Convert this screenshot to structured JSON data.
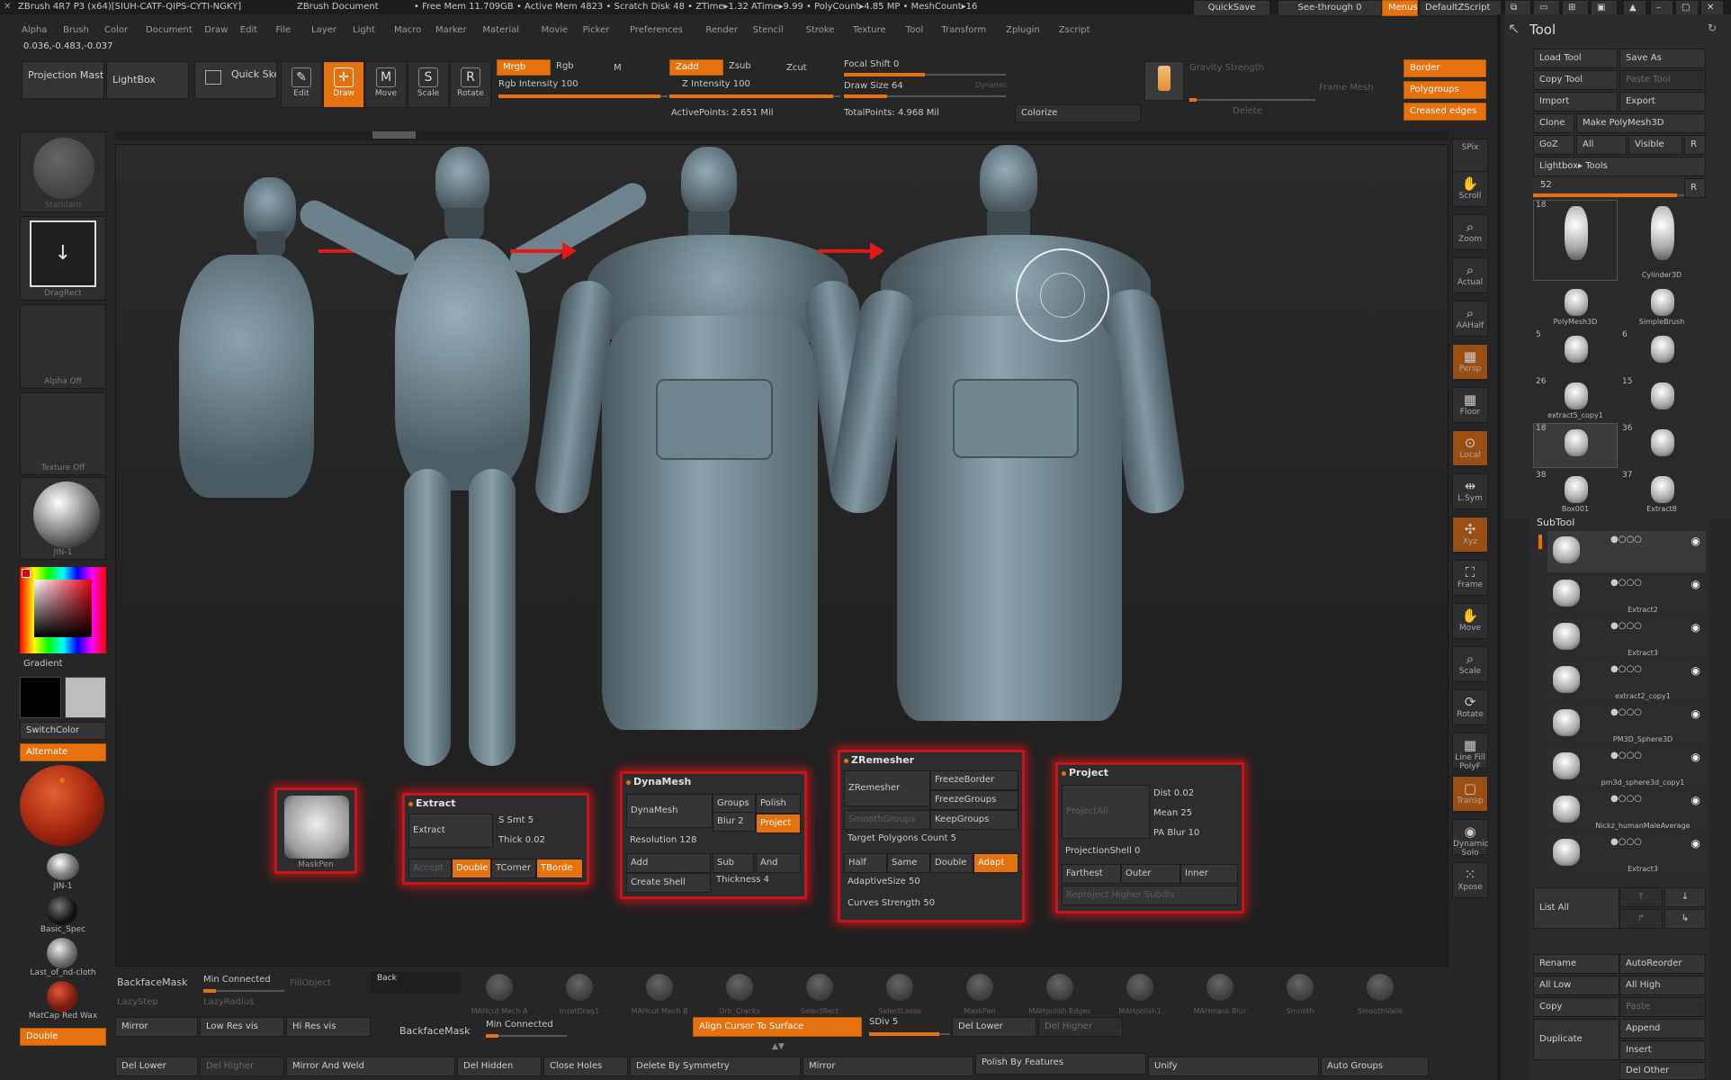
{
  "title_bar": {
    "app": "ZBrush 4R7 P3 (x64)[SIUH-CATF-QIPS-CYTI-NGKY]",
    "doc": "ZBrush Document",
    "stats": "• Free Mem 11.709GB • Active Mem 4823 • Scratch Disk 48 • ZTime▸1.32 ATime▸9.99 • PolyCount▸4.85 MP • MeshCount▸16",
    "quicksave": "QuickSave",
    "seethrough": "See-through 0",
    "menus": "Menus",
    "script": "DefaultZScript"
  },
  "menu": [
    "Alpha",
    "Brush",
    "Color",
    "Document",
    "Draw",
    "Edit",
    "File",
    "Layer",
    "Light",
    "Macro",
    "Marker",
    "Material",
    "Movie",
    "Picker",
    "Preferences",
    "Render",
    "Stencil",
    "Stroke",
    "Texture",
    "Tool",
    "Transform",
    "Zplugin",
    "Zscript"
  ],
  "coords": "0.036,-0.483,-0.037",
  "toolbar": {
    "projection_master": "Projection Master",
    "lightbox": "LightBox",
    "quick_sketch": "Quick Sketch",
    "edit": "Edit",
    "draw": "Draw",
    "move": "Move",
    "scale": "Scale",
    "rotate": "Rotate",
    "mrgb": "Mrgb",
    "rgb": "Rgb",
    "m": "M",
    "rgb_intensity": "Rgb Intensity 100",
    "zadd": "Zadd",
    "zsub": "Zsub",
    "zcut": "Zcut",
    "z_intensity": "Z Intensity 100",
    "focal_shift": "Focal Shift 0",
    "draw_size": "Draw Size 64",
    "dynamic": "Dynamic",
    "active_points": "ActivePoints: 2.651 Mil",
    "total_points": "TotalPoints: 4.968 Mil",
    "colorize": "Colorize",
    "gravity": "Gravity Strength",
    "frame_mesh": "Frame Mesh",
    "delete": "Delete",
    "border": "Border",
    "polygroups": "Polygroups",
    "creased": "Creased edges"
  },
  "left": {
    "standard": "Standard",
    "dragrect": "DragRect",
    "alpha_off": "Alpha Off",
    "texture_off": "Texture Off",
    "jin1": "JIN-1",
    "gradient": "Gradient",
    "switchcolor": "SwitchColor",
    "alternate": "Alternate",
    "jin1b": "JIN-1",
    "basic_spec": "Basic_Spec",
    "last_cloth": "Last_of_nd-cloth",
    "matcap": "MatCap Red Wax",
    "double": "Double"
  },
  "right_shelf": [
    "SPix",
    "Scroll",
    "Zoom",
    "Actual",
    "AAHalf",
    "Persp",
    "Floor",
    "Local",
    "L.Sym",
    "Xyz",
    "Frame",
    "Move",
    "Scale",
    "Rotate",
    "Line Fill PolyF",
    "Transp",
    "Dynamic Solo",
    "Xpose"
  ],
  "tool": {
    "header": "Tool",
    "load": "Load Tool",
    "save_as": "Save As",
    "copy": "Copy Tool",
    "paste": "Paste Tool",
    "import": "Import",
    "export": "Export",
    "clone": "Clone",
    "make_poly": "Make PolyMesh3D",
    "goz": "GoZ",
    "all": "All",
    "visible": "Visible",
    "r": "R",
    "lightbox_tools": "Lightbox▸ Tools",
    "count": "52",
    "items": [
      {
        "n": "18",
        "label": ""
      },
      {
        "n": "",
        "label": "Cylinder3D"
      },
      {
        "n": "",
        "label": "PolyMesh3D"
      },
      {
        "n": "",
        "label": "SimpleBrush"
      },
      {
        "n": "5",
        "label": ""
      },
      {
        "n": "6",
        "label": ""
      },
      {
        "n": "26",
        "label": "extract5_copy1"
      },
      {
        "n": "15",
        "label": ""
      },
      {
        "n": "18",
        "label": ""
      },
      {
        "n": "36",
        "label": ""
      },
      {
        "n": "38",
        "label": "Box001"
      },
      {
        "n": "37",
        "label": "Extract8"
      }
    ]
  },
  "subtool": {
    "header": "SubTool",
    "items": [
      "Extract2",
      "Extract3",
      "extract2_copy1",
      "PM3D_Sphere3D",
      "pm3d_sphere3d_copy1",
      "Nickz_humanMaleAverage",
      "Extract3"
    ],
    "list_all": "List All",
    "rename": "Rename",
    "autoreorder": "AutoReorder",
    "all_low": "All Low",
    "all_high": "All High",
    "copy": "Copy",
    "paste": "Paste",
    "duplicate": "Duplicate",
    "append": "Append",
    "insert": "Insert",
    "del_other": "Del Other"
  },
  "panels": {
    "maskpen": "MaskPen",
    "extract": {
      "title": "Extract",
      "extract": "Extract",
      "ssmt": "S Smt 5",
      "thick": "Thick 0.02",
      "accept": "Accept",
      "double": "Double",
      "tcorner": "TCorner",
      "tborder": "TBorde"
    },
    "dynamesh": {
      "title": "DynaMesh",
      "dynamesh": "DynaMesh",
      "groups": "Groups",
      "polish": "Polish",
      "blur": "Blur 2",
      "project": "Project",
      "resolution": "Resolution 128",
      "add": "Add",
      "sub": "Sub",
      "and": "And",
      "create_shell": "Create Shell",
      "thickness": "Thickness 4"
    },
    "zremesher": {
      "title": "ZRemesher",
      "zremesher": "ZRemesher",
      "freezeborder": "FreezeBorder",
      "freezegroups": "FreezeGroups",
      "smoothgroups": "SmoothGroups",
      "keepgroups": "KeepGroups",
      "target": "Target Polygons Count 5",
      "half": "Half",
      "same": "Same",
      "double": "Double",
      "adapt": "Adapt",
      "adaptive": "AdaptiveSize 50",
      "curves": "Curves Strength 50"
    },
    "project": {
      "title": "Project",
      "projectall": "ProjectAll",
      "dist": "Dist 0.02",
      "mean": "Mean 25",
      "pablur": "PA Blur 10",
      "shell": "ProjectionShell 0",
      "farthest": "Farthest",
      "outer": "Outer",
      "inner": "Inner",
      "reproject": "Reproject Higher Subdiv"
    }
  },
  "bottom": {
    "backfacemask": "BackfaceMask",
    "min_connected": "Min Connected",
    "fillobject": "FillObject",
    "back": "Back",
    "lazystep": "LazyStep",
    "lazyradius": "LazyRadius",
    "mirror": "Mirror",
    "low_res": "Low Res vis",
    "hi_res": "Hi Res vis",
    "backfacemask2": "BackfaceMask",
    "min_connected2": "Min Connected",
    "align": "Align Cursor To Surface",
    "sdiv": "SDiv 5",
    "del_lower": "Del Lower",
    "del_higher": "Del Higher",
    "double": "Double",
    "del_lower2": "Del Lower",
    "del_higher2": "Del Higher",
    "mirror_weld": "Mirror And Weld",
    "del_hidden": "Del Hidden",
    "close_holes": "Close Holes",
    "delete_sym": "Delete By Symmetry",
    "mirror2": "Mirror",
    "polish_features": "Polish By Features",
    "unify": "Unify",
    "auto_groups": "Auto Groups",
    "brushes": [
      "MAHcut Mech A",
      "InsetDrag1",
      "MAHcut Mech B",
      "Orb_Cracks",
      "SelectRect",
      "SelectLasso",
      "MaskPen",
      "MAHpolish Edges",
      "MAHpolish1",
      "MAHmask Blur",
      "Smooth",
      "SmoothValle"
    ]
  },
  "colors": {
    "accent": "#e5720e",
    "highlight": "#c4161c",
    "arrow": "#e2181a"
  }
}
